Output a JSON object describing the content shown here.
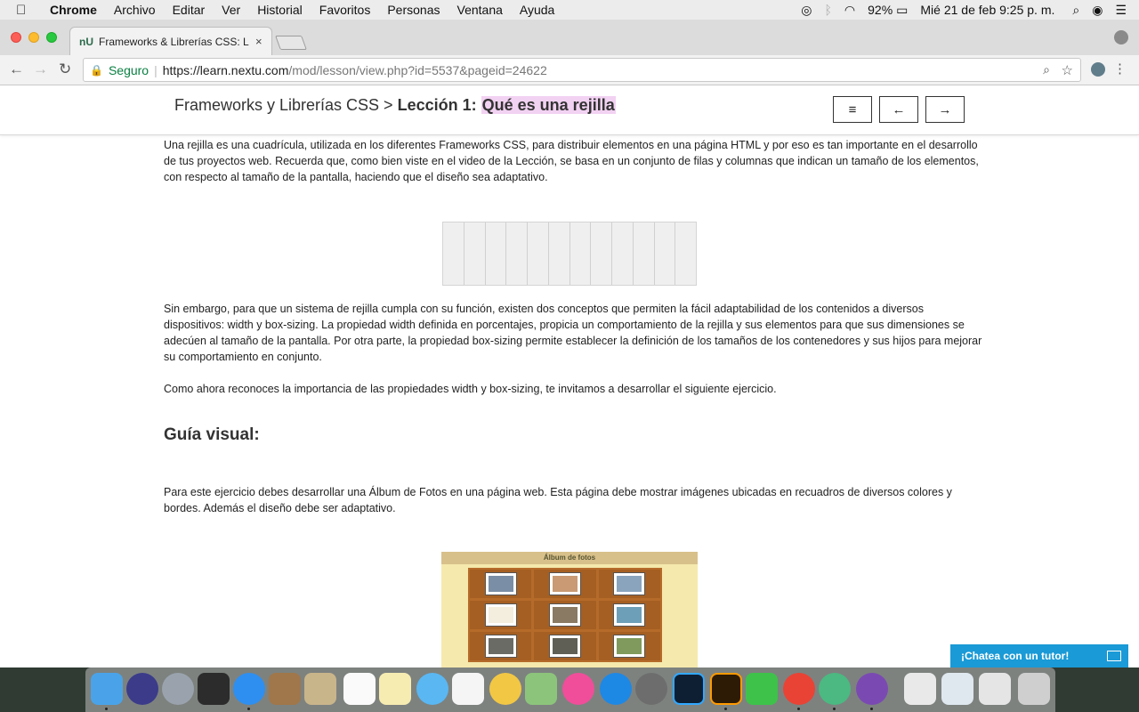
{
  "menubar": {
    "apple": "",
    "app": "Chrome",
    "items": [
      "Archivo",
      "Editar",
      "Ver",
      "Historial",
      "Favoritos",
      "Personas",
      "Ventana",
      "Ayuda"
    ],
    "battery": "92%",
    "datetime": "Mié 21 de feb  9:25 p. m."
  },
  "browser": {
    "tab_title": "Frameworks & Librerías CSS: L",
    "tab_favicon": "nU",
    "tab_close": "×",
    "security_label": "Seguro",
    "url_host": "https://learn.nextu.com",
    "url_path": "/mod/lesson/view.php?id=5537&pageid=24622"
  },
  "lesson": {
    "course": "Frameworks y Librerías CSS >",
    "lesson_label": "Lección 1:",
    "lesson_title": "Qué es una rejilla",
    "btn_menu": "≡",
    "btn_prev": "←",
    "btn_next": "→"
  },
  "content": {
    "p1": "Una rejilla es una cuadrícula, utilizada en los diferentes Frameworks CSS, para distribuir elementos en una página HTML y por eso es tan importante en el desarrollo de tus proyectos web. Recuerda que, como bien viste en el video de la Lección, se basa en un conjunto de filas y columnas que indican un tamaño de los elementos, con respecto al tamaño de la pantalla, haciendo que el diseño sea adaptativo.",
    "p2": "Sin embargo, para que un sistema de rejilla cumpla con su función, existen dos conceptos que permiten la fácil adaptabilidad de los contenidos a diversos dispositivos: width y box-sizing. La propiedad width definida en porcentajes, propicia un comportamiento de la rejilla y sus elementos para que sus dimensiones se adecúen al tamaño de la pantalla. Por otra parte, la propiedad box-sizing permite establecer la definición de los tamaños de los contenedores y sus hijos para mejorar su comportamiento en conjunto.",
    "p3": "Como ahora reconoces la importancia de las propiedades width y box-sizing, te invitamos a desarrollar el siguiente ejercicio.",
    "heading": "Guía visual:",
    "p4": "Para este ejercicio debes desarrollar una Álbum de Fotos en una página web. Esta página debe mostrar imágenes ubicadas en recuadros de diversos colores y bordes. Además el diseño debe ser adaptativo.",
    "album_title": "Álbum de fotos"
  },
  "chat": {
    "label": "¡Chatea con un tutor!"
  }
}
